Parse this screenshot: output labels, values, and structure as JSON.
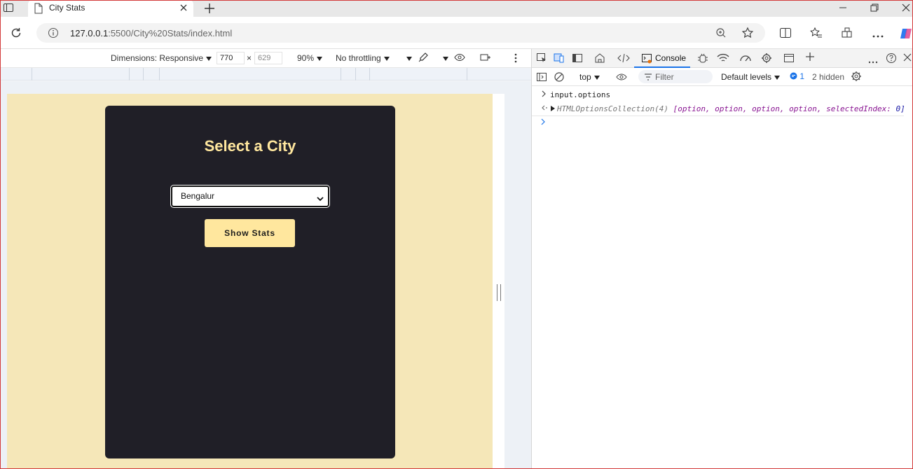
{
  "browser": {
    "tab_title": "City Stats",
    "url_host": "127.0.0.1",
    "url_rest": ":5500/City%20Stats/index.html"
  },
  "device_toolbar": {
    "dimensions_label": "Dimensions: Responsive",
    "width": "770",
    "times": "×",
    "height": "629",
    "zoom": "90%",
    "throttling": "No throttling"
  },
  "app": {
    "heading": "Select a City",
    "selected_city": "Bengalur",
    "button_label": "Show Stats",
    "colors": {
      "page_bg": "#f5e7b8",
      "card_bg": "#201f27",
      "accent": "#ffe79e"
    }
  },
  "devtools": {
    "console_tab": "Console",
    "context": "top",
    "filter_placeholder": "Filter",
    "levels": "Default levels",
    "message_count": "1",
    "hidden": "2 hidden",
    "console": {
      "input": "input.options",
      "result_obj": "HTMLOptionsCollection(4)",
      "result_items": "[option, option, option, option, selectedIndex:",
      "result_index": "0]"
    }
  }
}
